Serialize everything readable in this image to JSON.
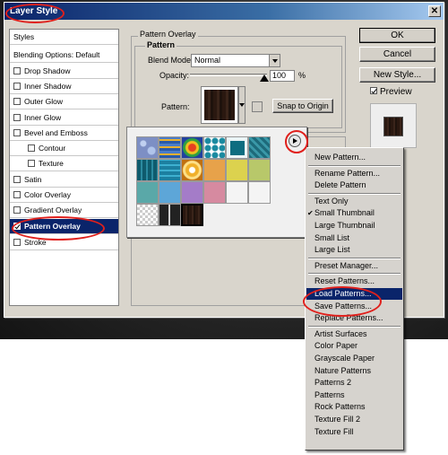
{
  "dialog": {
    "title": "Layer Style",
    "close_glyph": "✕"
  },
  "styles_list": {
    "items": [
      {
        "label": "Styles",
        "checkbox": false,
        "checked": false
      },
      {
        "label": "Blending Options: Default",
        "checkbox": false,
        "checked": false
      },
      {
        "label": "Drop Shadow",
        "checkbox": true,
        "checked": false
      },
      {
        "label": "Inner Shadow",
        "checkbox": true,
        "checked": false
      },
      {
        "label": "Outer Glow",
        "checkbox": true,
        "checked": false
      },
      {
        "label": "Inner Glow",
        "checkbox": true,
        "checked": false
      },
      {
        "label": "Bevel and Emboss",
        "checkbox": true,
        "checked": false
      },
      {
        "label": "Contour",
        "checkbox": true,
        "checked": false,
        "sub": true
      },
      {
        "label": "Texture",
        "checkbox": true,
        "checked": false,
        "sub": true
      },
      {
        "label": "Satin",
        "checkbox": true,
        "checked": false
      },
      {
        "label": "Color Overlay",
        "checkbox": true,
        "checked": false
      },
      {
        "label": "Gradient Overlay",
        "checkbox": true,
        "checked": false
      },
      {
        "label": "Pattern Overlay",
        "checkbox": true,
        "checked": true,
        "active": true
      },
      {
        "label": "Stroke",
        "checkbox": true,
        "checked": false
      }
    ]
  },
  "buttons": {
    "ok": "OK",
    "cancel": "Cancel",
    "new_style": "New Style...",
    "preview_label": "Preview",
    "preview_checked": true
  },
  "pattern_overlay": {
    "group_title": "Pattern Overlay",
    "subgroup_title": "Pattern",
    "blend_mode_label": "Blend Mode:",
    "blend_mode_value": "Normal",
    "opacity_label": "Opacity:",
    "opacity_value": "100",
    "opacity_unit": "%",
    "pattern_label": "Pattern:",
    "snap_button": "Snap to Origin"
  },
  "pattern_picker": {
    "tiles": [
      {
        "color": "#7d8fc4",
        "pattern": "bubbles"
      },
      {
        "color": "#3a6dbb",
        "pattern": "waves"
      },
      {
        "color": "#c8a24a",
        "pattern": "tiedye"
      },
      {
        "color": "#ffffff",
        "pattern": "dots-teal"
      },
      {
        "color": "#0e6d80",
        "pattern": "tealblock"
      },
      {
        "color": "#1d6a7a",
        "pattern": "tealblock2"
      },
      {
        "color": "#0f5b6d",
        "pattern": "tealgrid"
      },
      {
        "color": "#1c7fa0",
        "pattern": "tealgrid2"
      },
      {
        "color": "#f0b02a",
        "pattern": "flower"
      },
      {
        "color": "#e7a24a",
        "pattern": "solid"
      },
      {
        "color": "#dcd24e",
        "pattern": "solid"
      },
      {
        "color": "#b8c86a",
        "pattern": "solid"
      },
      {
        "color": "#5aa8a8",
        "pattern": "solid"
      },
      {
        "color": "#5da6d8",
        "pattern": "solid"
      },
      {
        "color": "#a47cc8",
        "pattern": "solid"
      },
      {
        "color": "#d68aa0",
        "pattern": "solid"
      },
      {
        "color": "#f4f4f4",
        "pattern": "blank"
      },
      {
        "color": "#f4f4f4",
        "pattern": "blank"
      },
      {
        "color": "#cccccc",
        "pattern": "checker"
      },
      {
        "color": "#222222",
        "pattern": "darkline"
      },
      {
        "color": "#2a1810",
        "pattern": "wood"
      }
    ]
  },
  "menu": {
    "items": [
      {
        "label": "New Pattern...",
        "sep_after": true
      },
      {
        "label": "Rename Pattern..."
      },
      {
        "label": "Delete Pattern",
        "sep_after": true
      },
      {
        "label": "Text Only"
      },
      {
        "label": "Small Thumbnail",
        "checked": true
      },
      {
        "label": "Large Thumbnail"
      },
      {
        "label": "Small List"
      },
      {
        "label": "Large List",
        "sep_after": true
      },
      {
        "label": "Preset Manager...",
        "sep_after": true
      },
      {
        "label": "Reset Patterns..."
      },
      {
        "label": "Load Patterns...",
        "highlighted": true
      },
      {
        "label": "Save Patterns..."
      },
      {
        "label": "Replace Patterns...",
        "sep_after": true
      },
      {
        "label": "Artist Surfaces"
      },
      {
        "label": "Color Paper"
      },
      {
        "label": "Grayscale Paper"
      },
      {
        "label": "Nature Patterns"
      },
      {
        "label": "Patterns 2"
      },
      {
        "label": "Patterns"
      },
      {
        "label": "Rock Patterns"
      },
      {
        "label": "Texture Fill 2"
      },
      {
        "label": "Texture Fill"
      }
    ]
  },
  "annotation_color": "#e0201c"
}
